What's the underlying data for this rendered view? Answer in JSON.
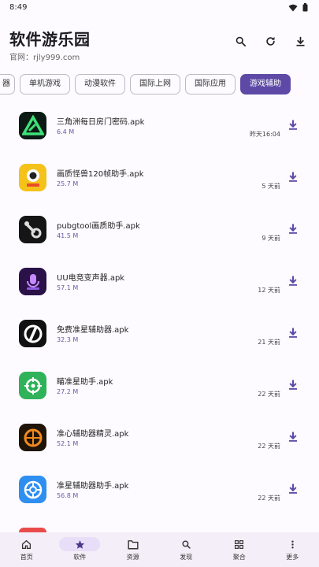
{
  "status": {
    "time": "8:49"
  },
  "header": {
    "title": "软件游乐园",
    "subtitle": "官网：rjly999.com",
    "search_icon": "search-icon",
    "refresh_icon": "refresh-icon",
    "download_icon": "download-icon"
  },
  "tabs": [
    {
      "label": "器",
      "active": false
    },
    {
      "label": "单机游戏",
      "active": false
    },
    {
      "label": "动漫软件",
      "active": false
    },
    {
      "label": "国际上网",
      "active": false
    },
    {
      "label": "国际应用",
      "active": false
    },
    {
      "label": "游戏辅助",
      "active": true
    }
  ],
  "apps": [
    {
      "name": "三角洲每日房门密码.apk",
      "size": "6.4 M",
      "date": "昨天16:04"
    },
    {
      "name": "画质怪兽120帧助手.apk",
      "size": "25.7 M",
      "date": "5 天前"
    },
    {
      "name": "pubgtool画质助手.apk",
      "size": "41.5 M",
      "date": "9 天前"
    },
    {
      "name": "UU电竞变声器.apk",
      "size": "57.1 M",
      "date": "12 天前"
    },
    {
      "name": "免费准星辅助器.apk",
      "size": "32.3 M",
      "date": "21 天前"
    },
    {
      "name": "瞄准星助手.apk",
      "size": "27.2 M",
      "date": "22 天前"
    },
    {
      "name": "准心辅助器精灵.apk",
      "size": "52.1 M",
      "date": "22 天前"
    },
    {
      "name": "准星辅助器助手.apk",
      "size": "56.8 M",
      "date": "22 天前"
    }
  ],
  "bottom_nav": [
    {
      "label": "首页",
      "icon": "home-icon",
      "active": false
    },
    {
      "label": "软件",
      "icon": "star-icon",
      "active": true
    },
    {
      "label": "资源",
      "icon": "folder-icon",
      "active": false
    },
    {
      "label": "发现",
      "icon": "search-icon",
      "active": false
    },
    {
      "label": "聚合",
      "icon": "grid-icon",
      "active": false
    },
    {
      "label": "更多",
      "icon": "more-vertical-icon",
      "active": false
    }
  ],
  "colors": {
    "accent": "#5e4aa6",
    "size_text": "#6a5aa8",
    "nav_bg": "#f3eef7",
    "nav_active": "#e8def8"
  }
}
